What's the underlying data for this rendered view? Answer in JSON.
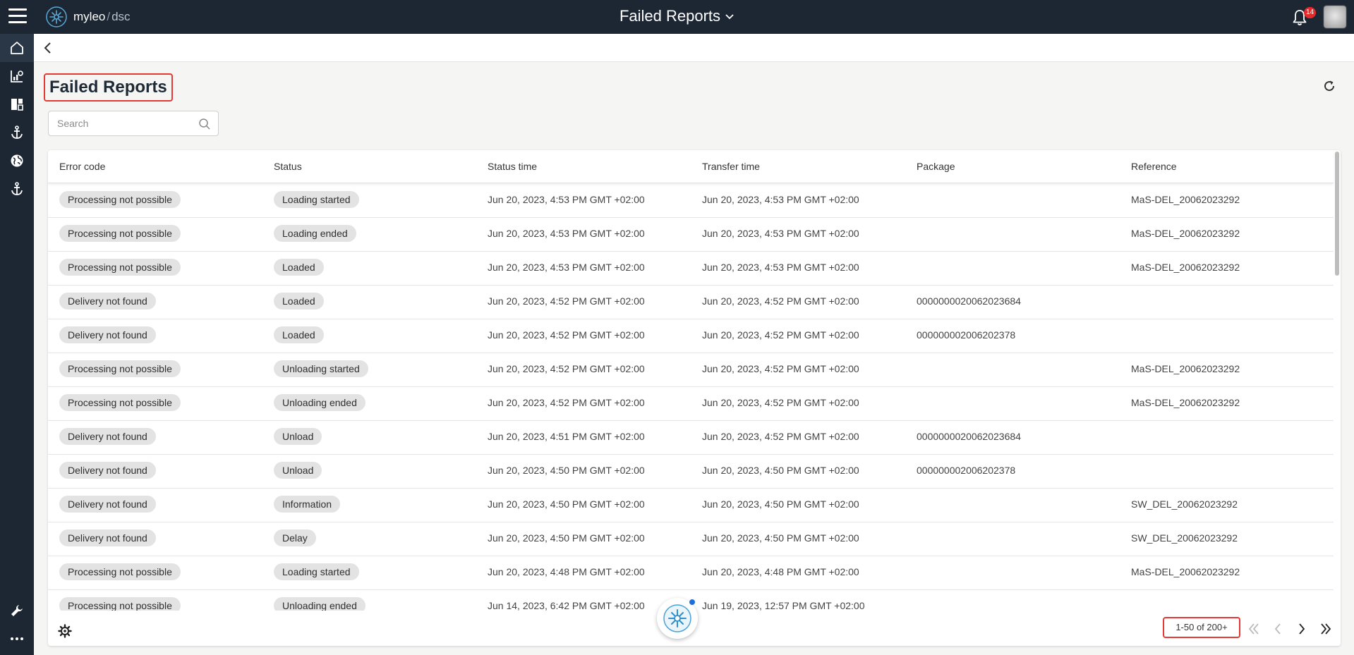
{
  "app": {
    "brand_name": "myleo",
    "brand_separator": "/",
    "brand_sub": "dsc",
    "title": "Failed Reports",
    "notification_count": "14"
  },
  "page": {
    "title": "Failed Reports",
    "search_placeholder": "Search"
  },
  "table": {
    "columns": [
      "Error code",
      "Status",
      "Status time",
      "Transfer time",
      "Package",
      "Reference"
    ],
    "rows": [
      {
        "error": "Processing not possible",
        "status": "Loading started",
        "status_time": "Jun 20, 2023, 4:53 PM GMT +02:00",
        "transfer_time": "Jun 20, 2023, 4:53 PM GMT +02:00",
        "package": "",
        "reference": "MaS-DEL_20062023292"
      },
      {
        "error": "Processing not possible",
        "status": "Loading ended",
        "status_time": "Jun 20, 2023, 4:53 PM GMT +02:00",
        "transfer_time": "Jun 20, 2023, 4:53 PM GMT +02:00",
        "package": "",
        "reference": "MaS-DEL_20062023292"
      },
      {
        "error": "Processing not possible",
        "status": "Loaded",
        "status_time": "Jun 20, 2023, 4:53 PM GMT +02:00",
        "transfer_time": "Jun 20, 2023, 4:53 PM GMT +02:00",
        "package": "",
        "reference": "MaS-DEL_20062023292"
      },
      {
        "error": "Delivery not found",
        "status": "Loaded",
        "status_time": "Jun 20, 2023, 4:52 PM GMT +02:00",
        "transfer_time": "Jun 20, 2023, 4:52 PM GMT +02:00",
        "package": "0000000020062023684",
        "reference": ""
      },
      {
        "error": "Delivery not found",
        "status": "Loaded",
        "status_time": "Jun 20, 2023, 4:52 PM GMT +02:00",
        "transfer_time": "Jun 20, 2023, 4:52 PM GMT +02:00",
        "package": "000000002006202378",
        "reference": ""
      },
      {
        "error": "Processing not possible",
        "status": "Unloading started",
        "status_time": "Jun 20, 2023, 4:52 PM GMT +02:00",
        "transfer_time": "Jun 20, 2023, 4:52 PM GMT +02:00",
        "package": "",
        "reference": "MaS-DEL_20062023292"
      },
      {
        "error": "Processing not possible",
        "status": "Unloading ended",
        "status_time": "Jun 20, 2023, 4:52 PM GMT +02:00",
        "transfer_time": "Jun 20, 2023, 4:52 PM GMT +02:00",
        "package": "",
        "reference": "MaS-DEL_20062023292"
      },
      {
        "error": "Delivery not found",
        "status": "Unload",
        "status_time": "Jun 20, 2023, 4:51 PM GMT +02:00",
        "transfer_time": "Jun 20, 2023, 4:52 PM GMT +02:00",
        "package": "0000000020062023684",
        "reference": ""
      },
      {
        "error": "Delivery not found",
        "status": "Unload",
        "status_time": "Jun 20, 2023, 4:50 PM GMT +02:00",
        "transfer_time": "Jun 20, 2023, 4:50 PM GMT +02:00",
        "package": "000000002006202378",
        "reference": ""
      },
      {
        "error": "Delivery not found",
        "status": "Information",
        "status_time": "Jun 20, 2023, 4:50 PM GMT +02:00",
        "transfer_time": "Jun 20, 2023, 4:50 PM GMT +02:00",
        "package": "",
        "reference": "SW_DEL_20062023292"
      },
      {
        "error": "Delivery not found",
        "status": "Delay",
        "status_time": "Jun 20, 2023, 4:50 PM GMT +02:00",
        "transfer_time": "Jun 20, 2023, 4:50 PM GMT +02:00",
        "package": "",
        "reference": "SW_DEL_20062023292"
      },
      {
        "error": "Processing not possible",
        "status": "Loading started",
        "status_time": "Jun 20, 2023, 4:48 PM GMT +02:00",
        "transfer_time": "Jun 20, 2023, 4:48 PM GMT +02:00",
        "package": "",
        "reference": "MaS-DEL_20062023292"
      },
      {
        "error": "Processing not possible",
        "status": "Unloading ended",
        "status_time": "Jun 14, 2023, 6:42 PM GMT +02:00",
        "transfer_time": "Jun 19, 2023, 12:57 PM GMT +02:00",
        "package": "",
        "reference": ""
      }
    ]
  },
  "pagination": {
    "range_text": "1-50 of 200+"
  },
  "icons": {
    "menu": "hamburger-menu-icon",
    "bell": "bell-icon",
    "back": "chevron-left-icon",
    "refresh": "refresh-icon",
    "search": "search-icon",
    "settings": "gear-icon",
    "rail": [
      "home-icon",
      "analytics-icon",
      "dashboard-icon",
      "anchor-icon",
      "globe-icon",
      "anchor-icon",
      "wrench-icon",
      "more-icon"
    ]
  },
  "colors": {
    "topbar": "#1c2733",
    "highlight": "#e53935",
    "chip": "#e3e3e3",
    "notification": "#e32b2b",
    "assistant_dot": "#1e6fd9"
  }
}
